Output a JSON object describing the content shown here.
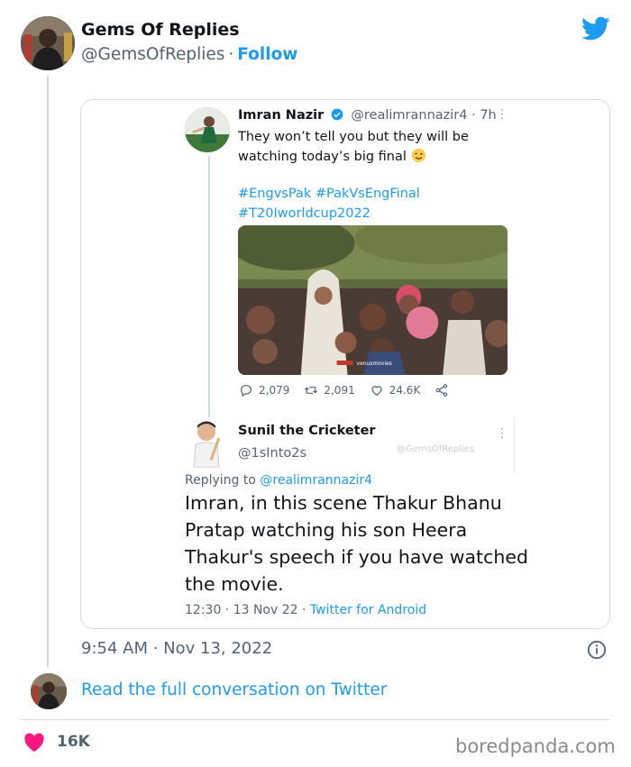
{
  "author": {
    "name": "Gems Of Replies",
    "handle": "@GemsOfReplies",
    "separator": "·",
    "follow_label": "Follow"
  },
  "quoted_screenshot": {
    "tweet": {
      "name": "Imran Nazir",
      "handle": "@realimrannazir4 · 7h",
      "text": "They won’t tell you but they will be watching today’s big final",
      "hashtags_line1": "#EngvsPak #PakVsEngFinal",
      "hashtags_line2": "#T20Iworldcup2022",
      "media_caption": "venusmovies",
      "replies": "2,079",
      "retweets": "2,091",
      "likes": "24.6K"
    },
    "reply": {
      "name": "Sunil the Cricketer",
      "handle": "@1sInto2s",
      "watermark": "@GemsOfReplies",
      "replying_prefix": "Replying to",
      "replying_to": "@realimrannazir4",
      "text": "Imran, in this scene Thakur Bhanu Pratap watching his son Heera Thakur's  speech if you have watched the movie.",
      "meta_time": "12:30 · 13 Nov 22 · ",
      "meta_client": "Twitter for Android"
    }
  },
  "timestamp": "9:54 AM · Nov 13, 2022",
  "read_more_label": "Read the full conversation on Twitter",
  "likes_count": "16K",
  "brand": "boredpanda.com",
  "colors": {
    "twitter_blue": "#1d9bf0",
    "like_red": "#f91880",
    "muted_text": "#536471"
  }
}
